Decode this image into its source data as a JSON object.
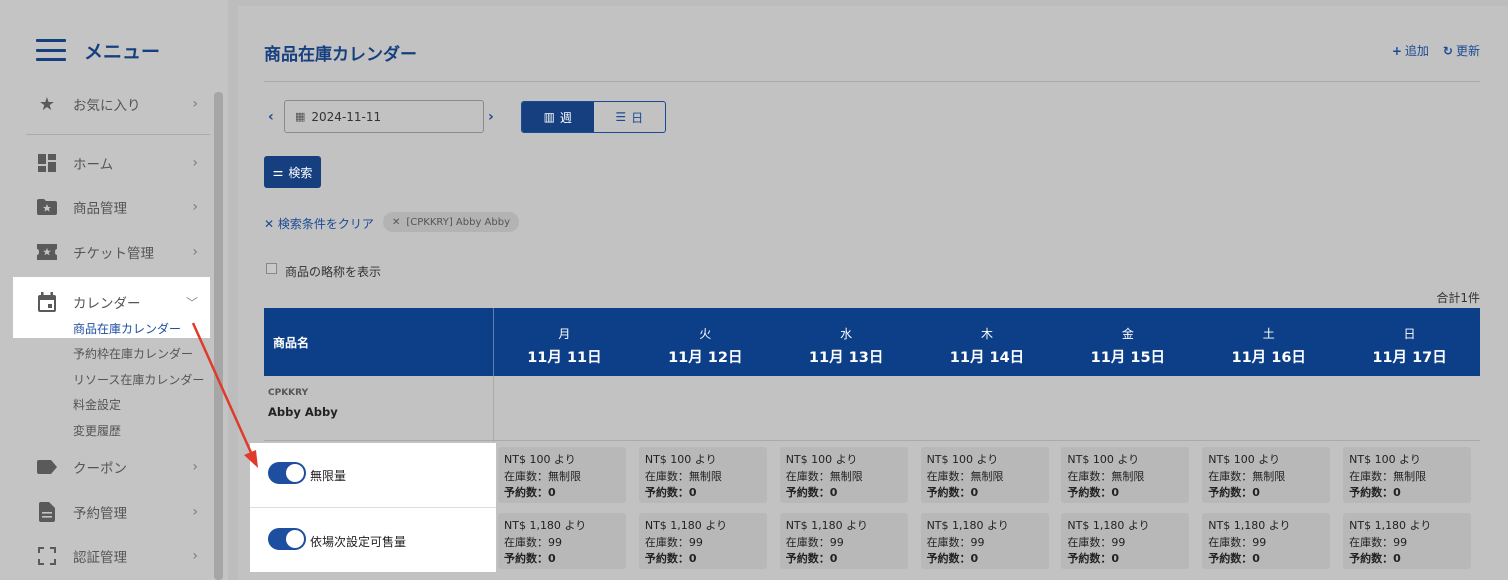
{
  "sidebar": {
    "title": "メニュー",
    "favorites": "お気に入り",
    "items": [
      {
        "label": "ホーム"
      },
      {
        "label": "商品管理"
      },
      {
        "label": "チケット管理"
      },
      {
        "label": "カレンダー"
      },
      {
        "label": "クーポン"
      },
      {
        "label": "予約管理"
      },
      {
        "label": "認証管理"
      }
    ],
    "calendar_sub": [
      "商品在庫カレンダー",
      "予約枠在庫カレンダー",
      "リソース在庫カレンダー",
      "料金設定",
      "変更履歴"
    ]
  },
  "header": {
    "title": "商品在庫カレンダー",
    "add": "追加",
    "refresh": "更新"
  },
  "toolbar": {
    "date": "2024-11-11",
    "view_week": "週",
    "view_day": "日",
    "search": "検索",
    "clear": "検索条件をクリア",
    "chip": "[CPKKRY] Abby Abby",
    "show_abbrev": "商品の略称を表示",
    "total": "合計1件"
  },
  "table": {
    "product_header": "商品名",
    "days": [
      {
        "dow": "月",
        "date": "11月 11日"
      },
      {
        "dow": "火",
        "date": "11月 12日"
      },
      {
        "dow": "水",
        "date": "11月 13日"
      },
      {
        "dow": "木",
        "date": "11月 14日"
      },
      {
        "dow": "金",
        "date": "11月 15日"
      },
      {
        "dow": "土",
        "date": "11月 16日"
      },
      {
        "dow": "日",
        "date": "11月 17日"
      }
    ],
    "product_code": "CPKKRY",
    "product_name": "Abby Abby",
    "rows": [
      {
        "toggle_label": "無限量",
        "price": "NT$ 100 より",
        "stock": "在庫数：無制限",
        "reserved": "予約数：0"
      },
      {
        "toggle_label": "依場次設定可售量",
        "price": "NT$ 1,180 より",
        "stock": "在庫数：99",
        "reserved": "予約数：0"
      }
    ]
  },
  "colors": {
    "brand": "#163f7f",
    "header_bg": "#0c3f87",
    "annotation_arrow": "#e03a2a"
  }
}
